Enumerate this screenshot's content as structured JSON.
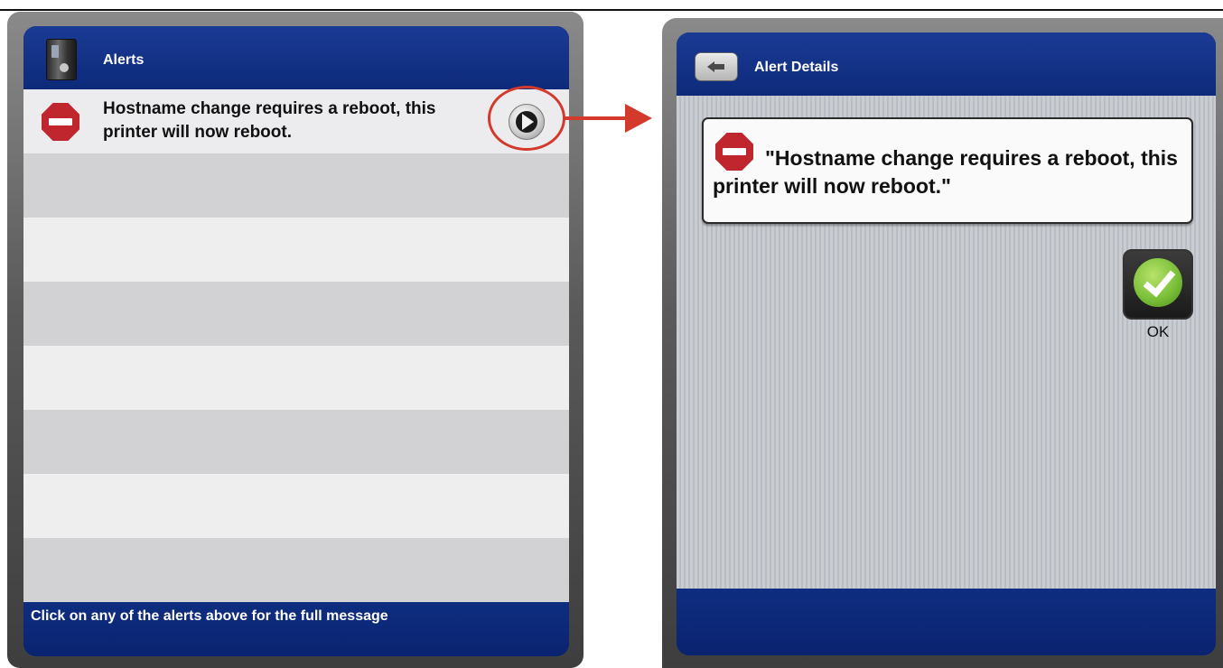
{
  "left_screen": {
    "header": {
      "title": "Alerts",
      "icon": "printer-icon"
    },
    "alerts": [
      {
        "message": "Hostname change requires a reboot, this printer will now reboot.",
        "icon": "stop-icon"
      }
    ],
    "footer": {
      "text": "Click on any of the alerts above for the full message"
    }
  },
  "right_screen": {
    "header": {
      "title": "Alert Details",
      "back_icon": "back-arrow-icon"
    },
    "message": "\"Hostname change requires a reboot, this printer will now reboot.\"",
    "ok_button": {
      "label": "OK",
      "icon": "check-icon"
    }
  },
  "colors": {
    "header_blue": "#0d2a7a",
    "highlight_red": "#d43a2c",
    "stop_red": "#c0262e",
    "ok_green": "#7cc03a"
  }
}
